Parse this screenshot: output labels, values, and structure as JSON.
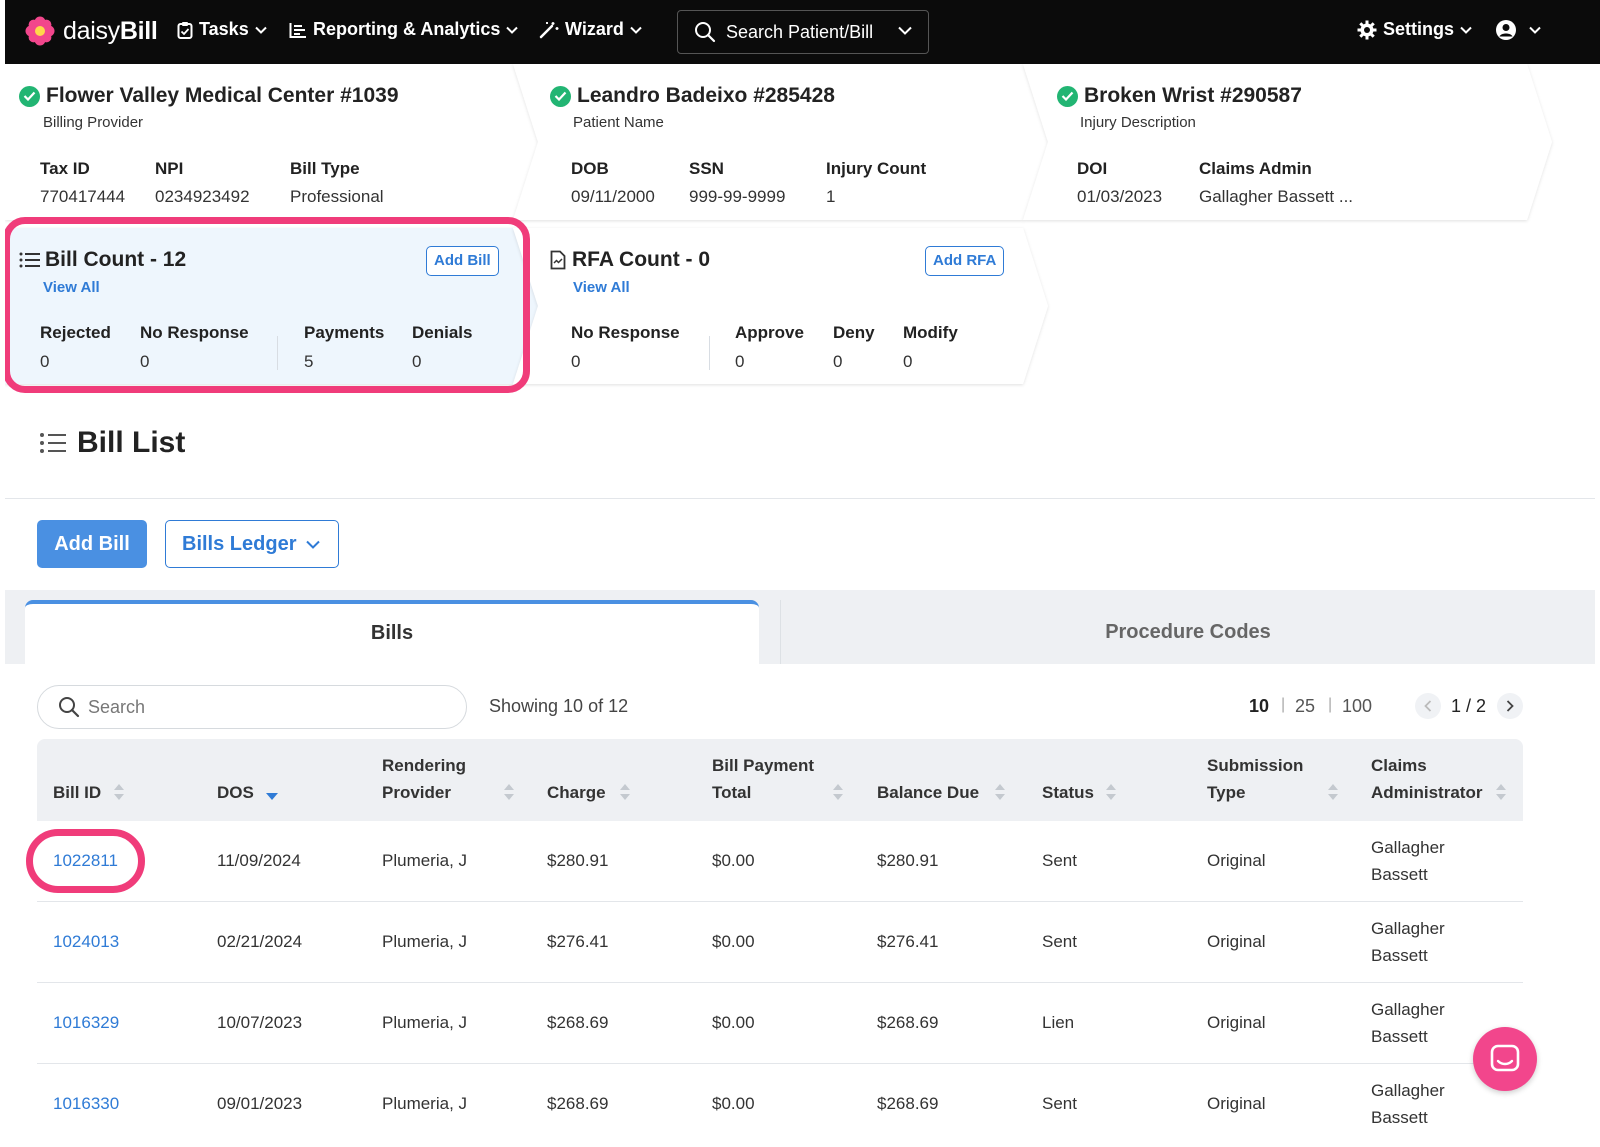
{
  "nav": {
    "brand_light": "daisy",
    "brand_bold": "Bill",
    "tasks": "Tasks",
    "reporting": "Reporting & Analytics",
    "wizard": "Wizard",
    "search": "Search Patient/Bill",
    "settings": "Settings"
  },
  "provider": {
    "title": "Flower Valley Medical Center #1039",
    "subtitle": "Billing Provider",
    "fields": [
      {
        "label": "Tax ID",
        "value": "770417444"
      },
      {
        "label": "NPI",
        "value": "0234923492"
      },
      {
        "label": "Bill Type",
        "value": "Professional"
      }
    ]
  },
  "patient": {
    "title": "Leandro Badeixo #285428",
    "subtitle": "Patient Name",
    "fields": [
      {
        "label": "DOB",
        "value": "09/11/2000"
      },
      {
        "label": "SSN",
        "value": "999-99-9999"
      },
      {
        "label": "Injury Count",
        "value": "1"
      }
    ]
  },
  "injury": {
    "title": "Broken Wrist #290587",
    "subtitle": "Injury Description",
    "fields": [
      {
        "label": "DOI",
        "value": "01/03/2023"
      },
      {
        "label": "Claims Admin",
        "value": "Gallagher Bassett ..."
      }
    ]
  },
  "bill_count": {
    "title": "Bill Count - 12",
    "view_all": "View All",
    "add_button": "Add Bill",
    "fields": [
      {
        "label": "Rejected",
        "value": "0"
      },
      {
        "label": "No Response",
        "value": "0"
      },
      {
        "label": "Payments",
        "value": "5"
      },
      {
        "label": "Denials",
        "value": "0"
      }
    ]
  },
  "rfa_count": {
    "title": "RFA Count - 0",
    "view_all": "View All",
    "add_button": "Add RFA",
    "fields": [
      {
        "label": "No Response",
        "value": "0"
      },
      {
        "label": "Approve",
        "value": "0"
      },
      {
        "label": "Deny",
        "value": "0"
      },
      {
        "label": "Modify",
        "value": "0"
      }
    ]
  },
  "bill_list": {
    "title": "Bill List",
    "add_bill": "Add Bill",
    "ledger": "Bills Ledger",
    "tabs": [
      "Bills",
      "Procedure Codes"
    ],
    "search_placeholder": "Search",
    "showing": "Showing 10 of 12",
    "page_sizes": [
      "10",
      "25",
      "100"
    ],
    "page": "1 / 2",
    "columns": [
      {
        "line1": "",
        "line2": "Bill ID"
      },
      {
        "line1": "",
        "line2": "DOS"
      },
      {
        "line1": "Rendering",
        "line2": "Provider"
      },
      {
        "line1": "",
        "line2": "Charge"
      },
      {
        "line1": "Bill Payment",
        "line2": "Total"
      },
      {
        "line1": "",
        "line2": "Balance Due"
      },
      {
        "line1": "",
        "line2": "Status"
      },
      {
        "line1": "Submission",
        "line2": "Type"
      },
      {
        "line1": "Claims",
        "line2": "Administrator"
      }
    ],
    "rows": [
      {
        "id": "1022811",
        "dos": "11/09/2024",
        "provider": "Plumeria, J",
        "charge": "$280.91",
        "paid": "$0.00",
        "balance": "$280.91",
        "status": "Sent",
        "type": "Original",
        "admin1": "Gallagher",
        "admin2": "Bassett"
      },
      {
        "id": "1024013",
        "dos": "02/21/2024",
        "provider": "Plumeria, J",
        "charge": "$276.41",
        "paid": "$0.00",
        "balance": "$276.41",
        "status": "Sent",
        "type": "Original",
        "admin1": "Gallagher",
        "admin2": "Bassett"
      },
      {
        "id": "1016329",
        "dos": "10/07/2023",
        "provider": "Plumeria, J",
        "charge": "$268.69",
        "paid": "$0.00",
        "balance": "$268.69",
        "status": "Lien",
        "type": "Original",
        "admin1": "Gallagher",
        "admin2": "Bassett"
      },
      {
        "id": "1016330",
        "dos": "09/01/2023",
        "provider": "Plumeria, J",
        "charge": "$268.69",
        "paid": "$0.00",
        "balance": "$268.69",
        "status": "Sent",
        "type": "Original",
        "admin1": "Gallagher",
        "admin2": "Bassett"
      }
    ]
  },
  "colors": {
    "nav_bg": "#0b0b0b",
    "accent": "#2f7bd6",
    "primary_button": "#4a90e2",
    "highlight": "#f03c7a",
    "check": "#22b573",
    "card_highlight_bg": "#eef6fd"
  }
}
